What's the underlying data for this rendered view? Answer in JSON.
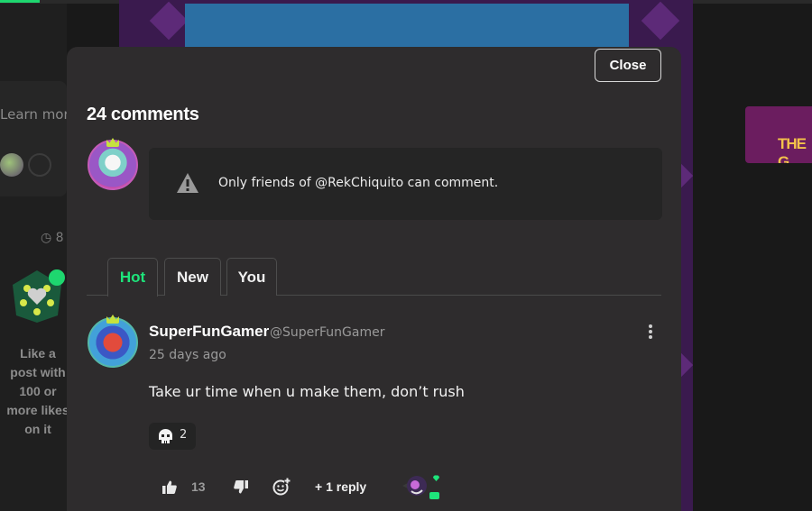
{
  "modal": {
    "close_label": "Close",
    "comments_count_label": "24 comments",
    "notice": {
      "icon": "warning-icon",
      "text": "Only friends of @RekChiquito can comment."
    },
    "tabs": [
      {
        "label": "Hot",
        "active": true
      },
      {
        "label": "New",
        "active": false
      },
      {
        "label": "You",
        "active": false
      }
    ],
    "comment": {
      "author": "SuperFunGamer",
      "handle": "@SuperFunGamer",
      "time": "25 days ago",
      "body": "Take ur time when u make them, don’t rush",
      "reaction": {
        "icon": "skull-icon",
        "count": "2"
      },
      "likes": "13",
      "reply_label": "+ 1 reply"
    }
  },
  "background": {
    "learn_more": "Learn more",
    "clock_text": "8",
    "badge_caption": "Like a post with 100 or more likes on it",
    "thumb_text": "THE G"
  },
  "colors": {
    "accent_green": "#1ee47b",
    "modal_bg": "#2e2c2d",
    "page_bg": "#191919"
  }
}
